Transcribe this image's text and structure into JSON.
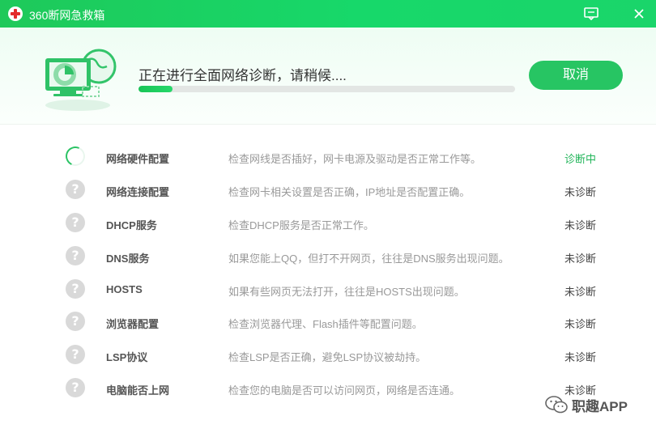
{
  "window": {
    "title": "360断网急救箱",
    "logo_icon": "red-cross-icon",
    "feedback_icon": "feedback-chat-icon",
    "close_icon": "close-icon"
  },
  "header": {
    "status_text": "正在进行全面网络诊断，请稍候....",
    "progress_fraction": 0.09,
    "cancel_label": "取消",
    "illustration_icon": "computer-globe-icon"
  },
  "colors": {
    "brand_green": "#1ec95a",
    "active_status": "#22b55a",
    "pending_icon": "#d9d9d9"
  },
  "items": [
    {
      "name": "网络硬件配置",
      "desc": "检查网线是否插好，网卡电源及驱动是否正常工作等。",
      "status": "诊断中",
      "state": "active",
      "icon": "loading-spinner-icon"
    },
    {
      "name": "网络连接配置",
      "desc": "检查网卡相关设置是否正确，IP地址是否配置正确。",
      "status": "未诊断",
      "state": "pending",
      "icon": "question-icon"
    },
    {
      "name": "DHCP服务",
      "desc": "检查DHCP服务是否正常工作。",
      "status": "未诊断",
      "state": "pending",
      "icon": "question-icon"
    },
    {
      "name": "DNS服务",
      "desc": "如果您能上QQ，但打不开网页，往往是DNS服务出现问题。",
      "status": "未诊断",
      "state": "pending",
      "icon": "question-icon"
    },
    {
      "name": "HOSTS",
      "desc": "如果有些网页无法打开，往往是HOSTS出现问题。",
      "status": "未诊断",
      "state": "pending",
      "icon": "question-icon"
    },
    {
      "name": "浏览器配置",
      "desc": "检查浏览器代理、Flash插件等配置问题。",
      "status": "未诊断",
      "state": "pending",
      "icon": "question-icon"
    },
    {
      "name": "LSP协议",
      "desc": "检查LSP是否正确，避免LSP协议被劫持。",
      "status": "未诊断",
      "state": "pending",
      "icon": "question-icon"
    },
    {
      "name": "电脑能否上网",
      "desc": "检查您的电脑是否可以访问网页，网络是否连通。",
      "status": "未诊断",
      "state": "pending",
      "icon": "question-icon"
    }
  ],
  "watermark": {
    "text": "职趣APP",
    "icon": "wechat-icon"
  }
}
